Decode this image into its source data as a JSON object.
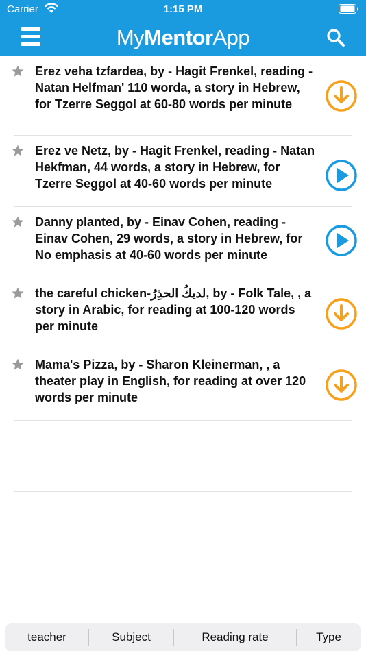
{
  "status": {
    "carrier": "Carrier",
    "time": "1:15 PM"
  },
  "header": {
    "logo_part1": "My",
    "logo_part2": "Mentor",
    "logo_part3": "App"
  },
  "items": [
    {
      "text": "Erez veha tzfardea, by - Hagit Frenkel, reading - Natan Helfman' 110 worda, a story in Hebrew, for Tzerre Seggol at 60-80 words per minute",
      "action": "download-icon"
    },
    {
      "text": "Erez ve Netz, by - Hagit Frenkel,  reading - Natan Hekfman, 44 words, a story in Hebrew, for Tzerre Seggol at 40-60 words per minute",
      "action": "play-icon"
    },
    {
      "text": "Danny planted, by - Einav Cohen,  reading - Einav Cohen, 29 words, a story in Hebrew, for No emphasis at 40-60 words per minute",
      "action": "play-icon"
    },
    {
      "text": "the careful chicken-لديكُ الحذِرُ, by - Folk Tale,  , a story in Arabic, for reading at 100-120 words per minute",
      "action": "download-icon"
    },
    {
      "text": "Mama's Pizza, by - Sharon Kleinerman,  , a theater play in English, for reading at over 120 words per minute",
      "action": "download-icon"
    }
  ],
  "filters": [
    {
      "label": "teacher"
    },
    {
      "label": "Subject"
    },
    {
      "label": "Reading rate"
    },
    {
      "label": "Type"
    }
  ],
  "colors": {
    "brand": "#1a9be0",
    "download": "#f5a11c",
    "play": "#1a9be0",
    "star": "#9a9a9a"
  }
}
